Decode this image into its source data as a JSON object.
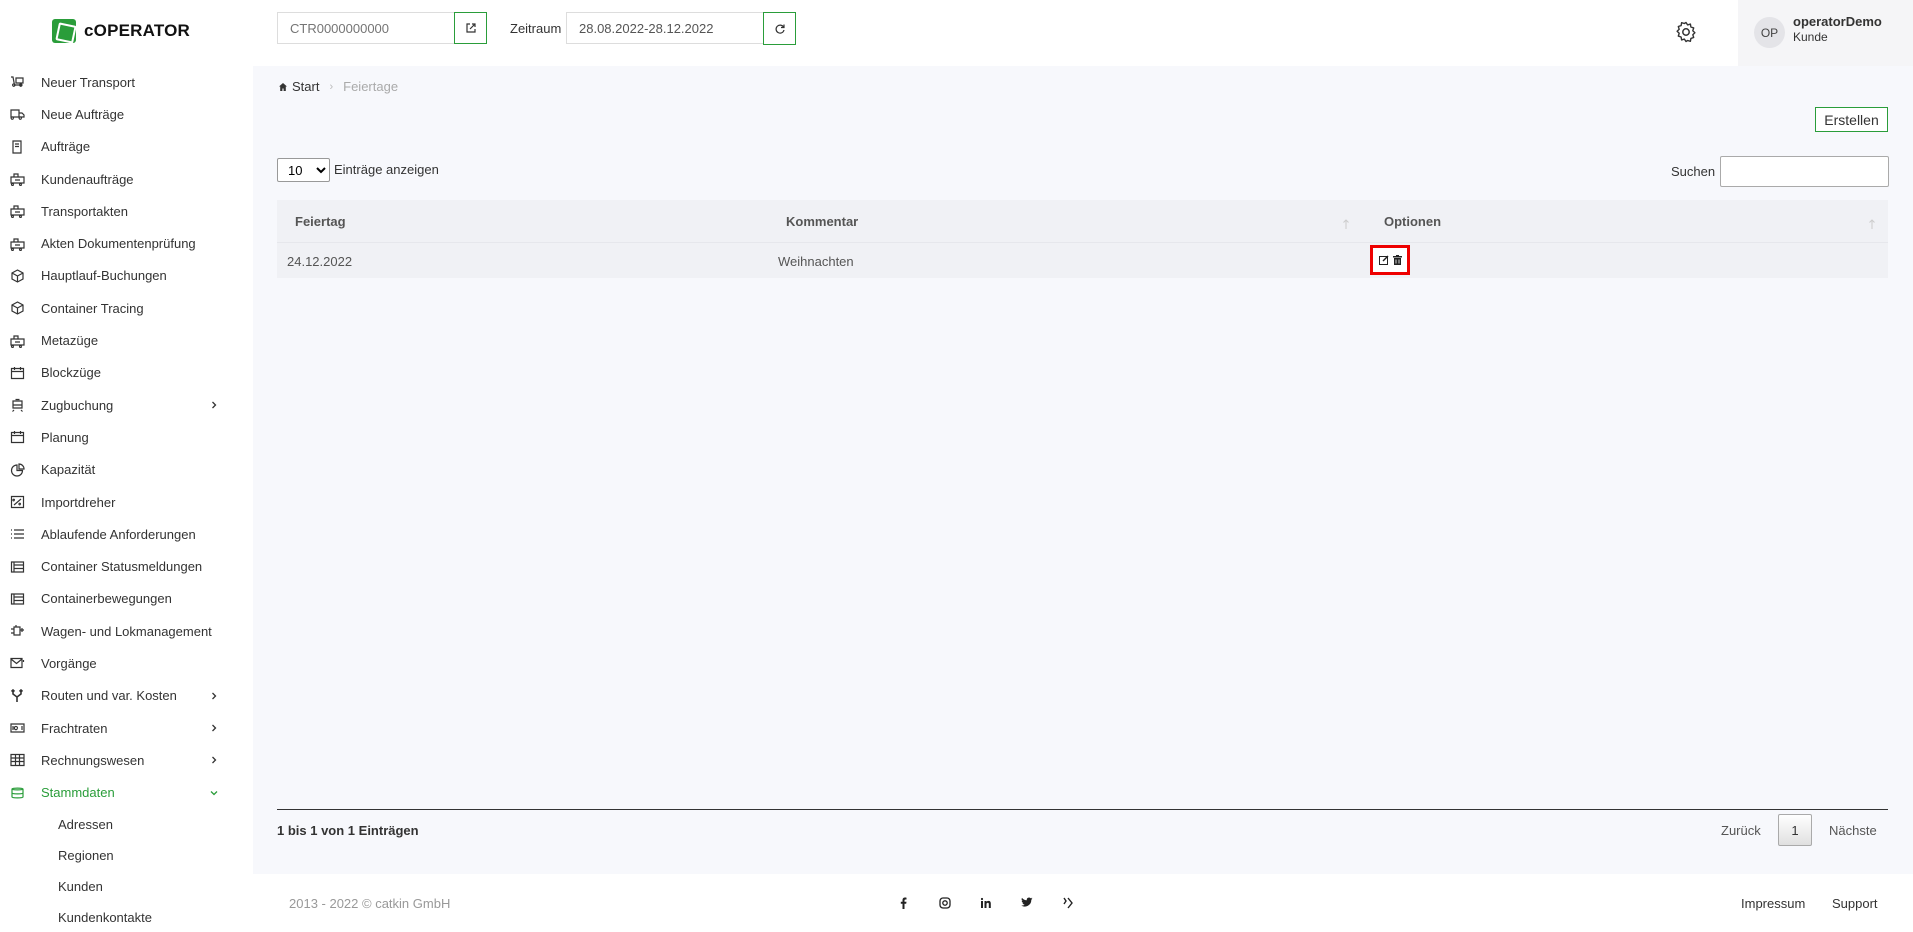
{
  "app": {
    "logo_text": "cOPERATOR"
  },
  "sidebar": {
    "items": [
      {
        "label": "Neuer Transport",
        "icon": "truck-icon"
      },
      {
        "label": "Neue Aufträge",
        "icon": "delivery-icon"
      },
      {
        "label": "Aufträge",
        "icon": "document-icon"
      },
      {
        "label": "Kundenaufträge",
        "icon": "train-icon"
      },
      {
        "label": "Transportakten",
        "icon": "train-icon"
      },
      {
        "label": "Akten Dokumentenprüfung",
        "icon": "train-icon"
      },
      {
        "label": "Hauptlauf-Buchungen",
        "icon": "cube-icon"
      },
      {
        "label": "Container Tracing",
        "icon": "cube-icon"
      },
      {
        "label": "Metazüge",
        "icon": "train-icon"
      },
      {
        "label": "Blockzüge",
        "icon": "calendar-icon"
      },
      {
        "label": "Zugbuchung",
        "icon": "tram-icon",
        "expandable": true
      },
      {
        "label": "Planung",
        "icon": "calendar-icon"
      },
      {
        "label": "Kapazität",
        "icon": "pie-chart-icon"
      },
      {
        "label": "Importdreher",
        "icon": "percent-icon"
      },
      {
        "label": "Ablaufende Anforderungen",
        "icon": "list-icon"
      },
      {
        "label": "Container Statusmeldungen",
        "icon": "grid-doc-icon"
      },
      {
        "label": "Containerbewegungen",
        "icon": "grid-doc-icon"
      },
      {
        "label": "Wagen- und Lokmanagement",
        "icon": "engine-icon"
      },
      {
        "label": "Vorgänge",
        "icon": "mail-icon"
      },
      {
        "label": "Routen und var. Kosten",
        "icon": "route-icon",
        "expandable": true
      },
      {
        "label": "Frachtraten",
        "icon": "money-icon",
        "expandable": true
      },
      {
        "label": "Rechnungswesen",
        "icon": "table-icon",
        "expandable": true
      },
      {
        "label": "Stammdaten",
        "icon": "database-icon",
        "expandable": true,
        "active": true
      }
    ],
    "sub_items": [
      "Adressen",
      "Regionen",
      "Kunden",
      "Kundenkontakte"
    ]
  },
  "header": {
    "ctr_placeholder": "CTR0000000000",
    "zeitraum_label": "Zeitraum",
    "zeitraum_value": "28.08.2022-28.12.2022",
    "user_initials": "OP",
    "user_name": "operatorDemo",
    "user_role": "Kunde"
  },
  "breadcrumb": {
    "home": "Start",
    "current": "Feiertage"
  },
  "toolbar": {
    "create_label": "Erstellen",
    "length_value": "10",
    "length_label": "Einträge anzeigen",
    "search_label": "Suchen"
  },
  "table": {
    "columns": [
      "Feiertag",
      "Kommentar",
      "Optionen"
    ],
    "rows": [
      {
        "feiertag": "24.12.2022",
        "kommentar": "Weihnachten"
      }
    ]
  },
  "pagination": {
    "info": "1 bis 1 von 1 Einträgen",
    "prev": "Zurück",
    "page": "1",
    "next": "Nächste"
  },
  "footer": {
    "copyright": "2013 - 2022 © catkin GmbH",
    "impressum": "Impressum",
    "support": "Support"
  },
  "colors": {
    "accent": "#2a9d3a",
    "highlight": "#e00000"
  }
}
